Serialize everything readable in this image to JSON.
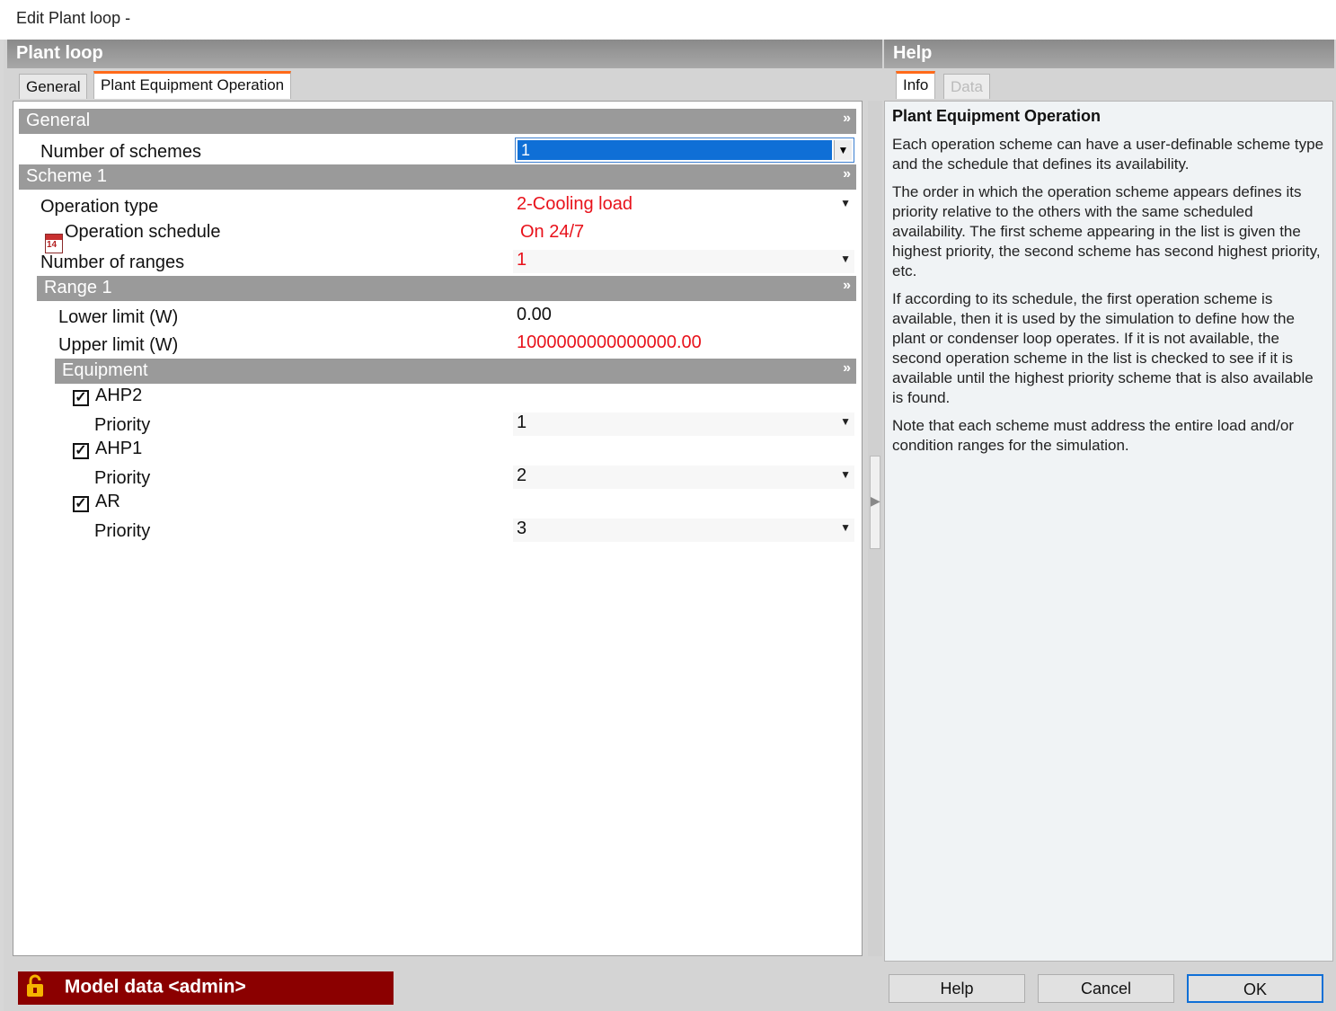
{
  "window": {
    "title": "Edit Plant loop -"
  },
  "left": {
    "header": "Plant loop",
    "tabs": [
      {
        "label": "General"
      },
      {
        "label": "Plant Equipment Operation"
      }
    ],
    "groups": {
      "general": "General",
      "scheme": "Scheme 1",
      "range": "Range 1",
      "equipment": "Equipment"
    },
    "fields": {
      "num_schemes_label": "Number of schemes",
      "num_schemes_value": "1",
      "op_type_label": "Operation type",
      "op_type_value": "2-Cooling load",
      "op_schedule_label": "Operation schedule",
      "op_schedule_value": "On 24/7",
      "num_ranges_label": "Number of ranges",
      "num_ranges_value": "1",
      "lower_label": "Lower limit (W)",
      "lower_value": "0.00",
      "upper_label": "Upper limit (W)",
      "upper_value": "1000000000000000.00"
    },
    "equipment": [
      {
        "name": "AHP2",
        "checked": true,
        "priority_label": "Priority",
        "priority": "1"
      },
      {
        "name": "AHP1",
        "checked": true,
        "priority_label": "Priority",
        "priority": "2"
      },
      {
        "name": "AR",
        "checked": true,
        "priority_label": "Priority",
        "priority": "3"
      }
    ]
  },
  "help": {
    "header": "Help",
    "tabs": [
      {
        "label": "Info"
      },
      {
        "label": "Data"
      }
    ],
    "title": "Plant Equipment Operation",
    "paragraphs": [
      "Each operation scheme can have a user-definable scheme type and the schedule that defines its availability.",
      "The order in which the operation scheme appears defines its priority relative to the others with the same scheduled availability. The first scheme appearing in the list is given the highest priority, the second scheme has second highest priority, etc.",
      "If according to its schedule, the first operation scheme is available, then it is used by the simulation to define how the plant or condenser loop operates. If it is not available, the second operation scheme in the list is checked to see if it is available until the highest priority scheme that is also available is found.",
      "Note that each scheme must address the entire load and/or condition ranges for the simulation."
    ]
  },
  "footer": {
    "model_label": "Model data <admin>",
    "buttons": {
      "help": "Help",
      "cancel": "Cancel",
      "ok": "OK"
    }
  },
  "icons": {
    "lock": "lock-icon",
    "calendar": "calendar-icon",
    "chevron": "double-chevron-down-icon",
    "dropdown": "dropdown-arrow-icon"
  },
  "colors": {
    "accent_tab": "#ff6a1a",
    "selection": "#0f6fd6",
    "error_text": "#e8121b",
    "model_bar": "#8b0000"
  }
}
